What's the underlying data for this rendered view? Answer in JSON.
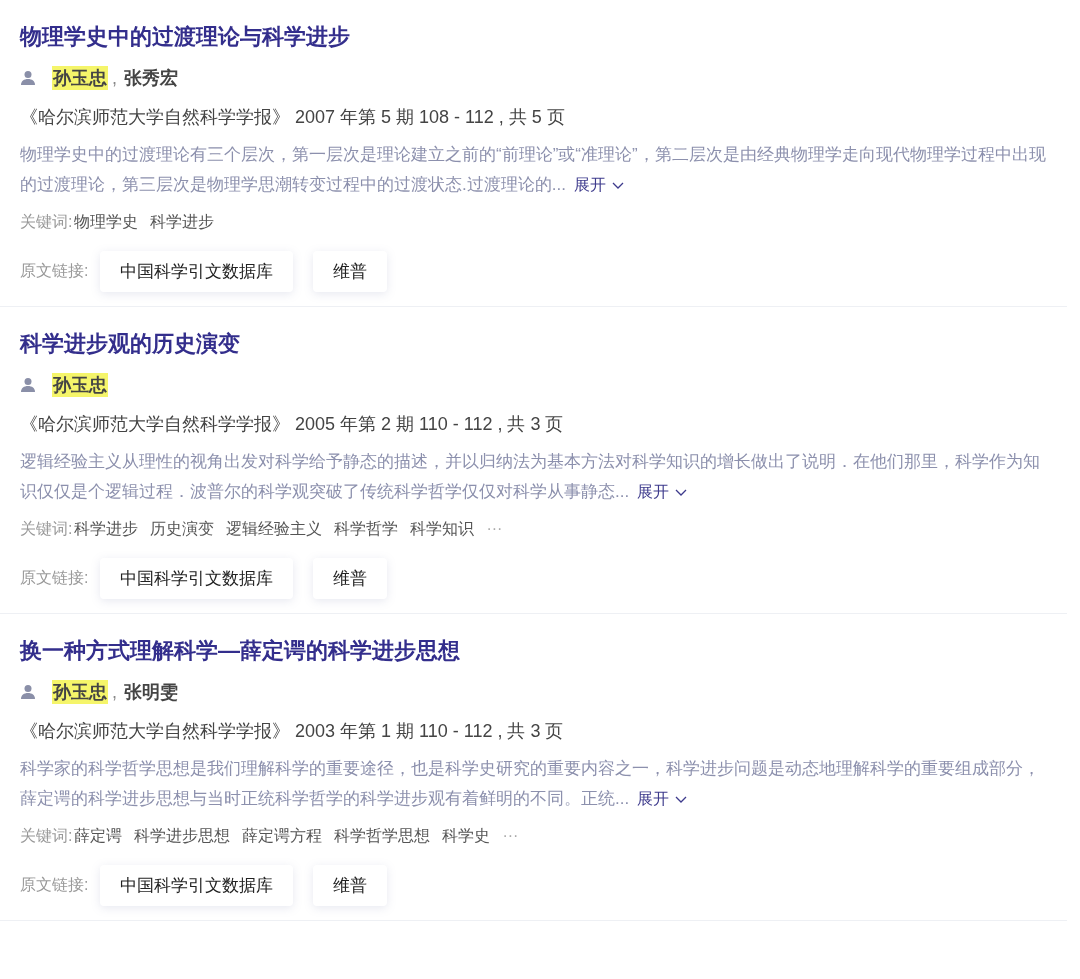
{
  "articles": [
    {
      "title": "物理学史中的过渡理论与科学进步",
      "authors": [
        {
          "name": "孙玉忠",
          "highlighted": true,
          "separator": ","
        },
        {
          "name": "张秀宏",
          "highlighted": false
        }
      ],
      "journal": "《哈尔滨师范大学自然科学学报》 2007 年第 5 期 108 - 112 , 共 5 页",
      "abstract": "物理学史中的过渡理论有三个层次，第一层次是理论建立之前的“前理论”或“准理论”，第二层次是由经典物理学走向现代物理学过程中出现的过渡理论，第三层次是物理学思潮转变过程中的过渡状态.过渡理论的...",
      "expand": "展开",
      "keywords_label": "关键词:",
      "keywords": [
        "物理学史",
        "科学进步"
      ],
      "links_label": "原文链接:",
      "links": [
        "中国科学引文数据库",
        "维普"
      ]
    },
    {
      "title": "科学进步观的历史演变",
      "authors": [
        {
          "name": "孙玉忠",
          "highlighted": true
        }
      ],
      "journal": "《哈尔滨师范大学自然科学学报》 2005 年第 2 期 110 - 112 , 共 3 页",
      "abstract": "逻辑经验主义从理性的视角出发对科学给予静态的描述，并以归纳法为基本方法对科学知识的增长做出了说明．在他们那里，科学作为知识仅仅是个逻辑过程．波普尔的科学观突破了传统科学哲学仅仅对科学从事静态...",
      "expand": "展开",
      "keywords_label": "关键词:",
      "keywords": [
        "科学进步",
        "历史演变",
        "逻辑经验主义",
        "科学哲学",
        "科学知识"
      ],
      "keywords_more": "···",
      "links_label": "原文链接:",
      "links": [
        "中国科学引文数据库",
        "维普"
      ]
    },
    {
      "title": "换一种方式理解科学—薛定谔的科学进步思想",
      "authors": [
        {
          "name": "孙玉忠",
          "highlighted": true,
          "separator": ","
        },
        {
          "name": "张明雯",
          "highlighted": false
        }
      ],
      "journal": "《哈尔滨师范大学自然科学学报》 2003 年第 1 期 110 - 112 , 共 3 页",
      "abstract": "科学家的科学哲学思想是我们理解科学的重要途径，也是科学史研究的重要内容之一，科学进步问题是动态地理解科学的重要组成部分，薛定谔的科学进步思想与当时正统科学哲学的科学进步观有着鲜明的不同。正统...",
      "expand": "展开",
      "keywords_label": "关键词:",
      "keywords": [
        "薛定谔",
        "科学进步思想",
        "薛定谔方程",
        "科学哲学思想",
        "科学史"
      ],
      "keywords_more": "···",
      "links_label": "原文链接:",
      "links": [
        "中国科学引文数据库",
        "维普"
      ]
    }
  ]
}
